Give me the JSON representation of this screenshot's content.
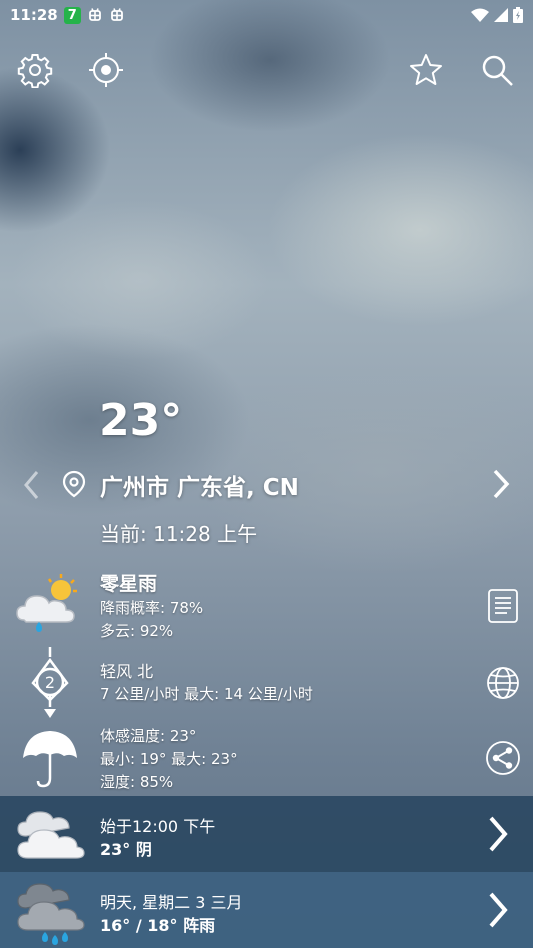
{
  "status_bar": {
    "time": "11:28",
    "badge": "7",
    "notif_icons": [
      "bug-icon",
      "bug-icon"
    ],
    "right_icons": [
      "wifi-icon",
      "signal-icon",
      "battery-icon"
    ]
  },
  "toolbar": {
    "icons": [
      "settings-icon",
      "locate-icon",
      "favorite-star-icon",
      "search-icon"
    ]
  },
  "current": {
    "temperature": "23°",
    "location": "广州市 广东省, CN",
    "time_label": "当前: 11:28 上午"
  },
  "conditions": {
    "summary": "零星雨",
    "precip": "降雨概率: 78%",
    "cloud": "多云: 92%"
  },
  "wind": {
    "speed_level": "2",
    "label": "轻风 北",
    "speeds": "7 公里/小时 最大: 14 公里/小时"
  },
  "feels": {
    "feels_like": "体感温度: 23°",
    "min_max": "最小: 19° 最大: 23°",
    "humidity": "湿度: 85%"
  },
  "forecast": [
    {
      "line1": "始于12:00 下午",
      "line2": "23° 阴",
      "icon": "cloudy-icon"
    },
    {
      "line1": "明天, 星期二 3 三月",
      "line2": "16° / 18° 阵雨",
      "icon": "rain-cloud-icon"
    }
  ],
  "colors": {
    "band_dark": "#284660",
    "band_light": "#3a6080",
    "status_badge": "#25b34a"
  }
}
